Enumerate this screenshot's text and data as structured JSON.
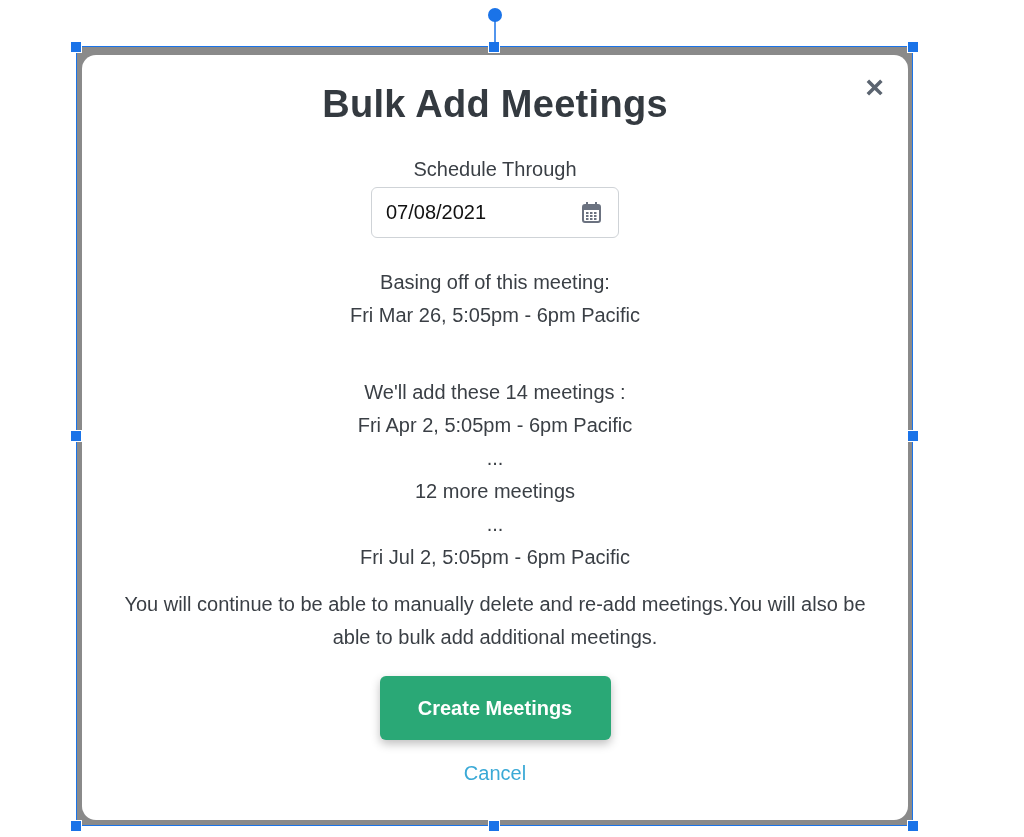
{
  "dialog": {
    "title": "Bulk Add Meetings",
    "close": "×",
    "schedule_field": {
      "label": "Schedule Through",
      "value": "07/08/2021"
    },
    "basing": [
      "Basing off of this meeting:",
      "Fri Mar 26, 5:05pm - 6pm Pacific"
    ],
    "added": [
      "We'll add these 14 meetings :",
      "Fri Apr 2, 5:05pm - 6pm Pacific",
      "...",
      "12 more meetings",
      "...",
      "Fri Jul 2, 5:05pm - 6pm Pacific"
    ],
    "note": "You will continue to be able to manually delete and re-add meetings.You will also be able to bulk add additional meetings.",
    "primary_button": "Create Meetings",
    "cancel_link": "Cancel"
  }
}
